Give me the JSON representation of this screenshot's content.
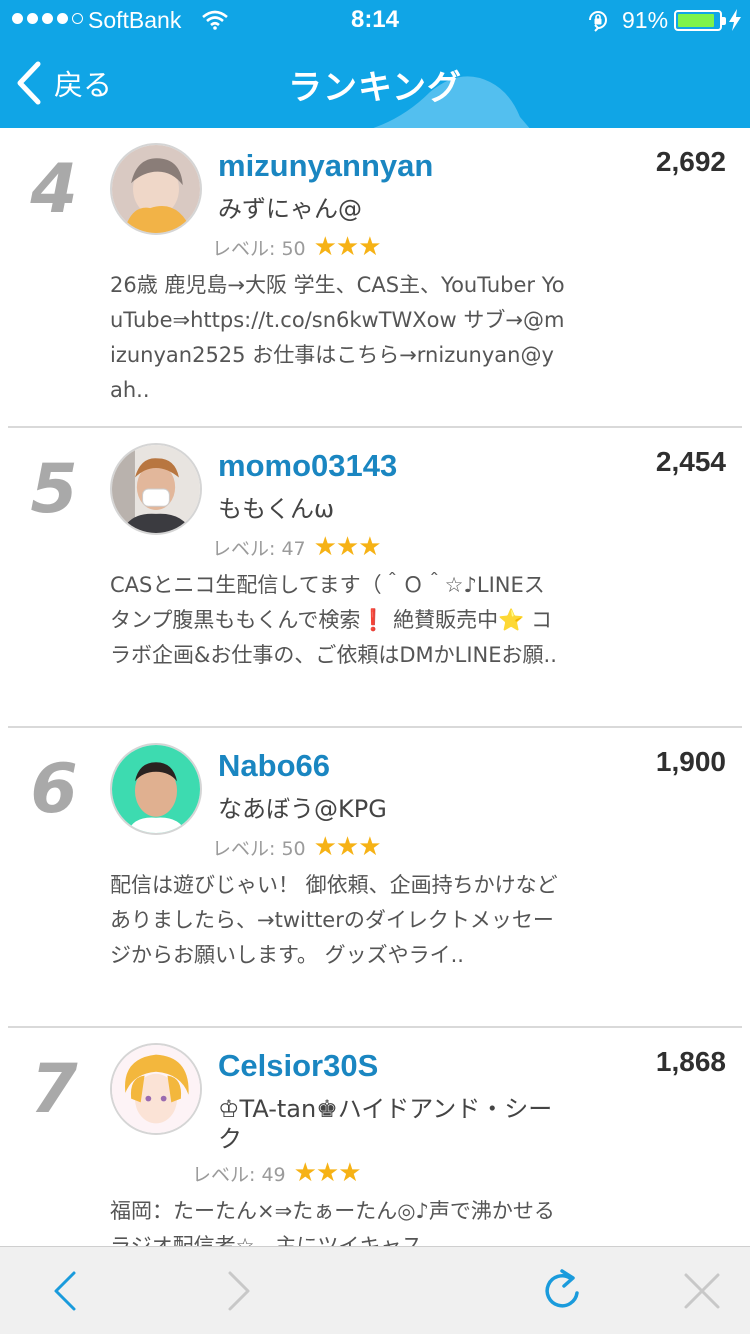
{
  "status_bar": {
    "carrier": "SoftBank",
    "time": "8:14",
    "battery_percent": "91%",
    "battery_level": 0.91,
    "signal_bars_filled": 4,
    "signal_bars_total": 5
  },
  "nav": {
    "back_label": "戻る",
    "title": "ランキング"
  },
  "colors": {
    "header_bg": "#10a5e6",
    "username": "#1a86c1",
    "star": "#f6b215",
    "toolbar_icon_active": "#1a9bdc",
    "toolbar_icon_disabled": "#c8c8c8"
  },
  "ranking": [
    {
      "rank": "4",
      "username": "mizunyannyan",
      "display_name": "みずにゃん@",
      "level_label": "レベル: 50",
      "stars": "★★★",
      "bio": "26歳 鹿児島→大阪 学生、CAS主、YouTuber YouTube⇒https://t.co/sn6kwTWXow サブ→@mizunyan2525 お仕事はこちら→rnizunyan@yah..",
      "score": "2,692"
    },
    {
      "rank": "5",
      "username": "momo03143",
      "display_name": "ももくんω",
      "level_label": "レベル: 47",
      "stars": "★★★",
      "bio": "CASとニコ生配信してます（＾Ｏ＾☆♪LINEスタンプ腹黒ももくんで検索❗️ 絶賛販売中⭐️ コラボ企画&お仕事の、ご依頼はDMかLINEお願..",
      "score": "2,454"
    },
    {
      "rank": "6",
      "username": "Nabo66",
      "display_name": "なあぼう@KPG",
      "level_label": "レベル: 50",
      "stars": "★★★",
      "bio": "配信は遊びじゃい！ 御依頼、企画持ちかけなどありましたら、→twitterのダイレクトメッセージからお願いします。 グッズやライ..",
      "score": "1,900"
    },
    {
      "rank": "7",
      "username": "Celsior30S",
      "display_name": "♔TA-tan♚ハイドアンド・シーク",
      "level_label": "レベル: 49",
      "stars": "★★★",
      "bio": "福岡：たーたん×⇒たぁーたん◎♪声で沸かせるラジオ配信者☆。主にツイキャス",
      "score": "1,868"
    }
  ],
  "toolbar": {
    "icons": [
      "back-arrow-icon",
      "forward-arrow-icon",
      "reload-icon",
      "close-icon"
    ]
  }
}
